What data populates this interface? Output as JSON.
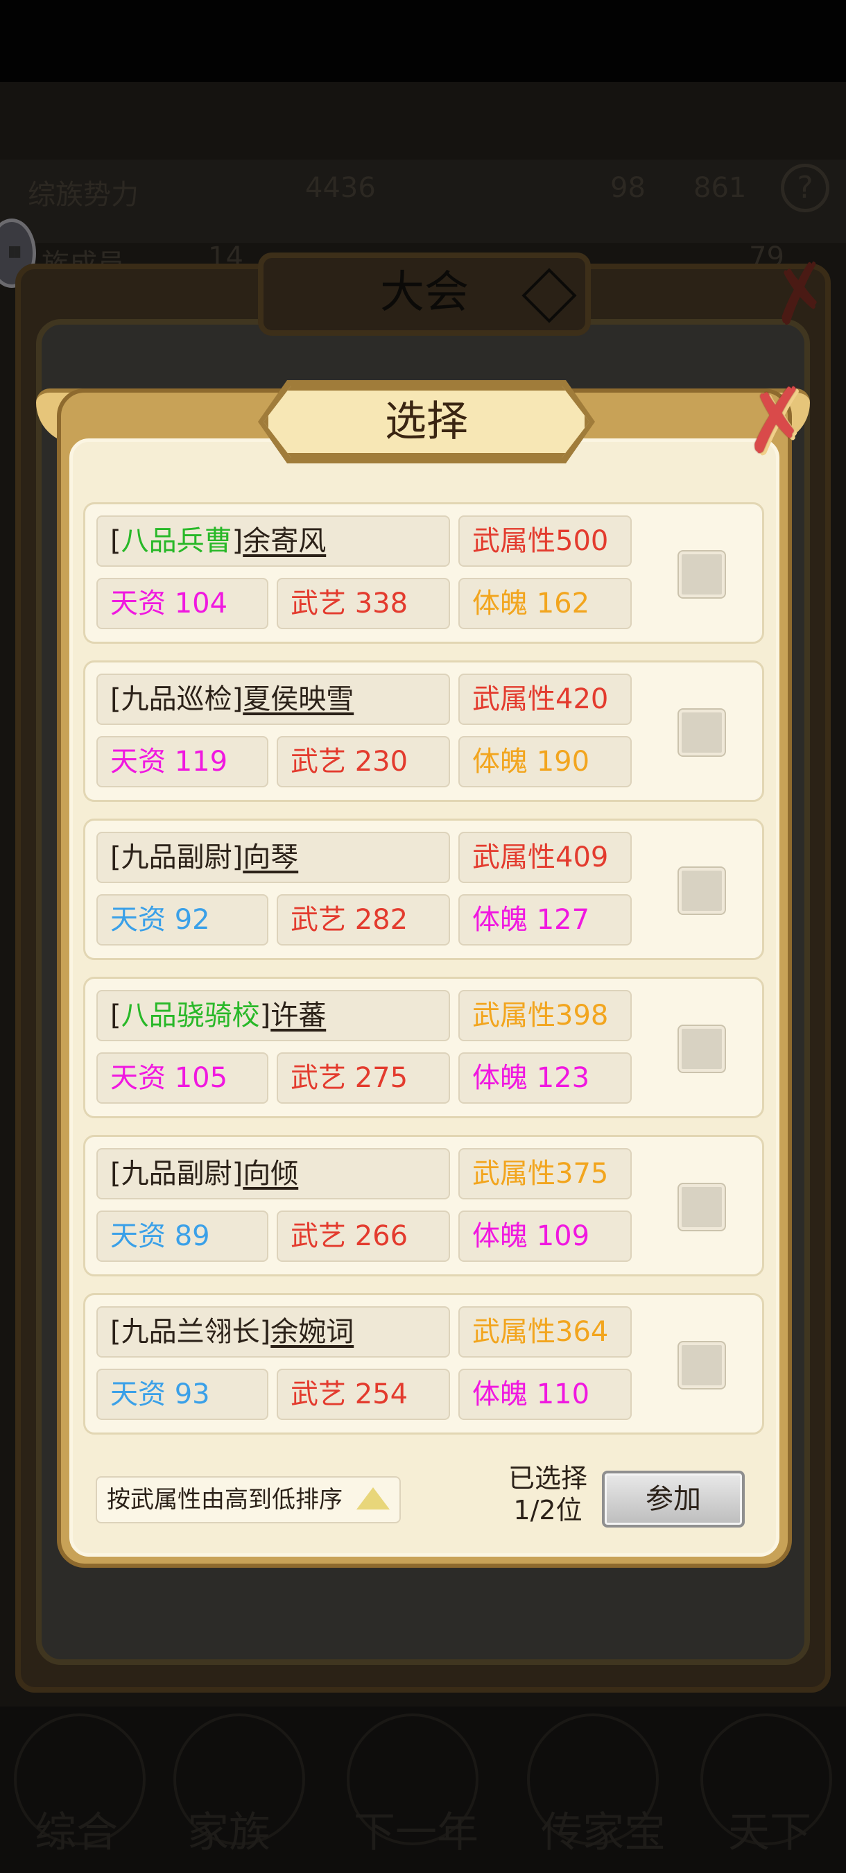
{
  "background": {
    "stats": [
      "综族势力",
      "4436",
      "98",
      "861"
    ],
    "row2": [
      "族成员",
      "14",
      "79"
    ],
    "dialog_title": "大会",
    "nav": [
      "综合",
      "家族",
      "下一年",
      "传家宝",
      "天下"
    ]
  },
  "modal": {
    "title": "选择",
    "close_glyph": "✗"
  },
  "candidates": [
    {
      "rank": "八品兵曹",
      "name": "余寄风",
      "attr_label": "武属性",
      "attr": "500",
      "tz_label": "天资",
      "tz": "104",
      "wy_label": "武艺",
      "wy": "338",
      "tp_label": "体魄",
      "tp": "162"
    },
    {
      "rank": "九品巡检",
      "name": "夏侯映雪",
      "attr_label": "武属性",
      "attr": "420",
      "tz_label": "天资",
      "tz": "119",
      "wy_label": "武艺",
      "wy": "230",
      "tp_label": "体魄",
      "tp": "190"
    },
    {
      "rank": "九品副尉",
      "name": "向琴",
      "attr_label": "武属性",
      "attr": "409",
      "tz_label": "天资",
      "tz": "92",
      "wy_label": "武艺",
      "wy": "282",
      "tp_label": "体魄",
      "tp": "127"
    },
    {
      "rank": "八品骁骑校",
      "name": "许蕃",
      "attr_label": "武属性",
      "attr": "398",
      "tz_label": "天资",
      "tz": "105",
      "wy_label": "武艺",
      "wy": "275",
      "tp_label": "体魄",
      "tp": "123"
    },
    {
      "rank": "九品副尉",
      "name": "向倾",
      "attr_label": "武属性",
      "attr": "375",
      "tz_label": "天资",
      "tz": "89",
      "wy_label": "武艺",
      "wy": "266",
      "tp_label": "体魄",
      "tp": "109"
    },
    {
      "rank": "九品兰翎长",
      "name": "余婉词",
      "attr_label": "武属性",
      "attr": "364",
      "tz_label": "天资",
      "tz": "93",
      "wy_label": "武艺",
      "wy": "254",
      "tp_label": "体魄",
      "tp": "110"
    }
  ],
  "colors": {
    "rank_green": "#28b828",
    "rank_dark": "#2b2118",
    "attr_red": "#e33b2e",
    "attr_orange": "#f2a51e",
    "tz_magenta": "#f018e0",
    "tz_blue": "#3aa0e8",
    "wy_red": "#e33b2e",
    "tp_orange": "#f2a51e",
    "tp_magenta": "#f018e0"
  },
  "footer": {
    "sort_label": "按武属性由高到低排序",
    "selected_line1": "已选择",
    "selected_line2": "1/2位",
    "join_label": "参加"
  }
}
